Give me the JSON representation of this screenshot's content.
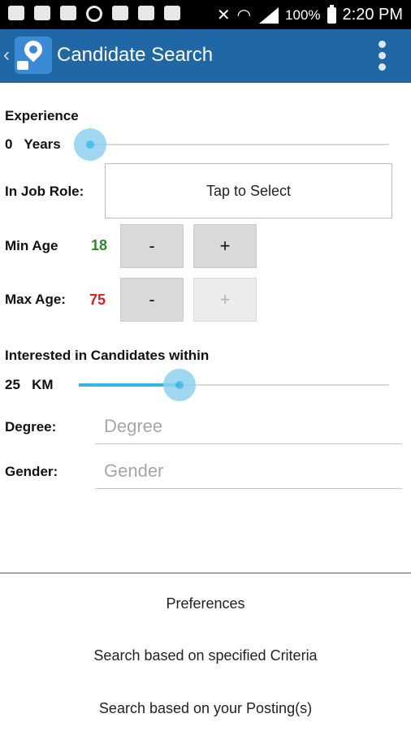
{
  "status_bar": {
    "battery": "100%",
    "time": "2:20 PM",
    "icons": [
      "bbm-icon",
      "figure-icon",
      "image-icon",
      "target-icon",
      "card-icon",
      "card-icon",
      "card-icon",
      "mute-icon",
      "wifi-icon",
      "signal-icon",
      "battery-icon"
    ]
  },
  "app_bar": {
    "title": "Candidate Search",
    "accent": "#1f67a5"
  },
  "experience": {
    "label": "Experience",
    "value": "0",
    "unit": "Years",
    "slider_fraction": 0
  },
  "job_role": {
    "label": "In Job Role:",
    "value": "Tap to Select"
  },
  "min_age": {
    "label": "Min Age",
    "value": "18",
    "value_color": "#2c8a2c",
    "decrement_label": "-",
    "increment_label": "+"
  },
  "max_age": {
    "label": "Max Age:",
    "value": "75",
    "value_color": "#e31c1c",
    "decrement_label": "-",
    "increment_label": "+"
  },
  "radius": {
    "label": "Interested in Candidates within",
    "value": "25",
    "unit": "KM",
    "slider_fraction": 0.32
  },
  "degree": {
    "label": "Degree:",
    "placeholder": "Degree"
  },
  "gender": {
    "label": "Gender:",
    "placeholder": "Gender"
  },
  "actions": {
    "preferences": "Preferences",
    "search_criteria": "Search based on specified Criteria",
    "search_postings": "Search based on your Posting(s)"
  },
  "slider_color": "#33b5e5"
}
